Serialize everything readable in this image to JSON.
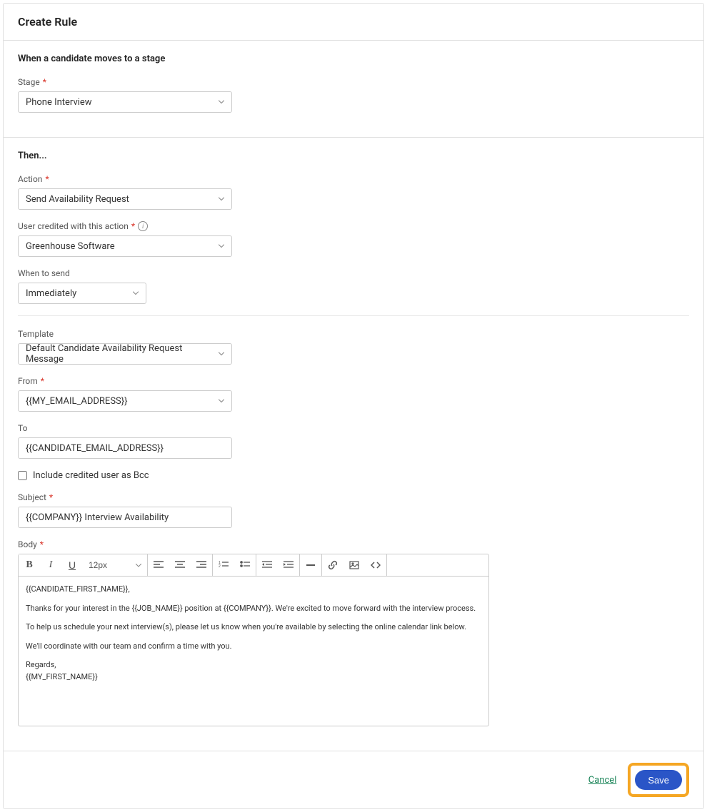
{
  "header": {
    "title": "Create Rule"
  },
  "when": {
    "heading": "When a candidate moves to a stage",
    "stage_label": "Stage",
    "stage_value": "Phone Interview"
  },
  "then": {
    "heading": "Then...",
    "action_label": "Action",
    "action_value": "Send Availability Request",
    "user_label": "User credited with this action",
    "user_value": "Greenhouse Software",
    "when_to_send_label": "When to send",
    "when_to_send_value": "Immediately",
    "template_label": "Template",
    "template_value": "Default Candidate Availability Request Message",
    "from_label": "From",
    "from_value": "{{MY_EMAIL_ADDRESS}}",
    "to_label": "To",
    "to_value": "{{CANDIDATE_EMAIL_ADDRESS}}",
    "bcc_label": "Include credited user as Bcc",
    "subject_label": "Subject",
    "subject_value": "{{COMPANY}} Interview Availability",
    "body_label": "Body",
    "font_size": "12px",
    "body_lines": {
      "l1": "{{CANDIDATE_FIRST_NAME}},",
      "l2": "Thanks for your interest in the {{JOB_NAME}} position at {{COMPANY}}. We're excited to move forward with the interview process.",
      "l3": "To help us schedule your next interview(s), please let us know when you're available by selecting the online calendar link below.",
      "l4": "We'll coordinate with our team and confirm a time with you.",
      "l5": "Regards,",
      "l6": "{{MY_FIRST_NAME}}"
    }
  },
  "footer": {
    "cancel": "Cancel",
    "save": "Save"
  }
}
